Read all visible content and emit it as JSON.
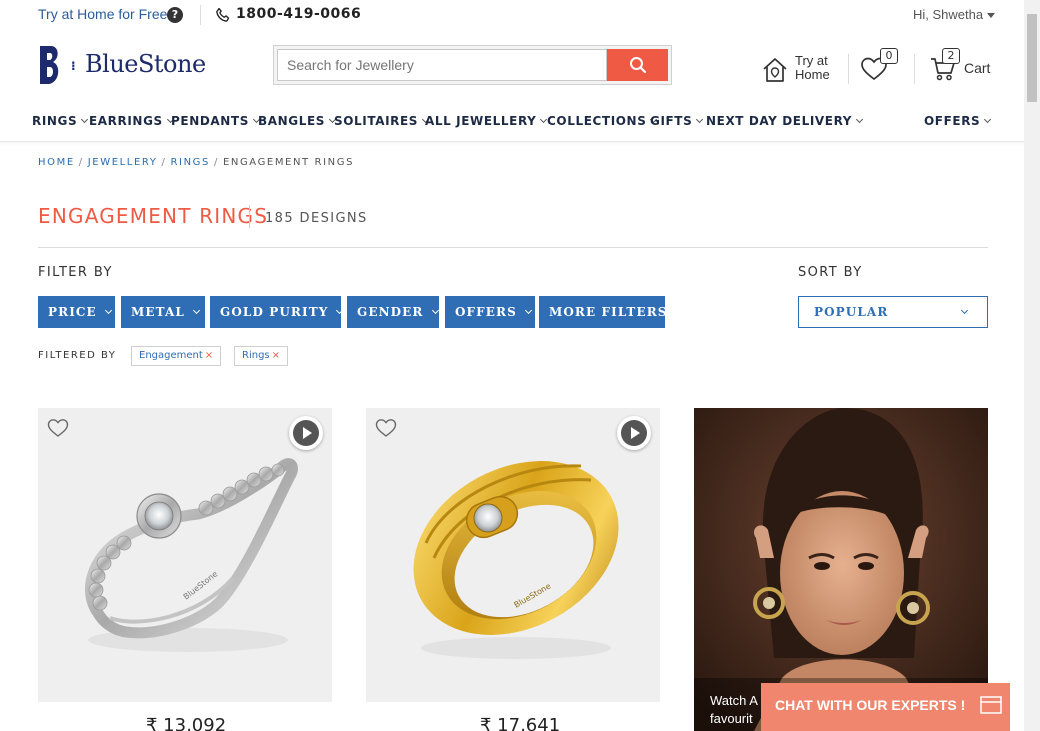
{
  "topbar": {
    "try_home": "Try at Home for Free",
    "help_glyph": "?",
    "phone": "1800-419-0066",
    "greeting": "Hi, Shwetha"
  },
  "header": {
    "logo_text": "BlueStone",
    "search": {
      "placeholder": "Search for Jewellery",
      "value": ""
    },
    "try_home_line1": "Try at",
    "try_home_line2": "Home",
    "wishlist_count": "0",
    "cart_count": "2",
    "cart_label": "Cart"
  },
  "nav": [
    {
      "label": "RINGS"
    },
    {
      "label": "EARRINGS"
    },
    {
      "label": "PENDANTS"
    },
    {
      "label": "BANGLES"
    },
    {
      "label": "SOLITAIRES"
    },
    {
      "label": "ALL JEWELLERY"
    },
    {
      "label": "COLLECTIONS"
    },
    {
      "label": "GIFTS"
    },
    {
      "label": "NEXT DAY DELIVERY"
    },
    {
      "label": "OFFERS"
    }
  ],
  "breadcrumb": {
    "items": [
      "HOME",
      "JEWELLERY",
      "RINGS"
    ],
    "separator": "/",
    "current": "ENGAGEMENT RINGS"
  },
  "page": {
    "title": "ENGAGEMENT RINGS",
    "count": "185 DESIGNS"
  },
  "filters": {
    "label": "FILTER BY",
    "buttons": [
      "PRICE",
      "METAL",
      "GOLD PURITY",
      "GENDER",
      "OFFERS",
      "MORE FILTERS"
    ],
    "applied_label": "FILTERED BY",
    "applied": [
      "Engagement",
      "Rings"
    ],
    "remove_glyph": "×"
  },
  "sort": {
    "label": "SORT BY",
    "selected": "POPULAR"
  },
  "products": [
    {
      "price": "₹ 13,092",
      "metal": "white gold"
    },
    {
      "price": "₹ 17,641",
      "metal": "yellow gold"
    }
  ],
  "ad": {
    "caption_line1": "Watch A",
    "caption_line2": "favourit"
  },
  "chat": {
    "label": "CHAT WITH OUR EXPERTS !"
  },
  "colors": {
    "brand_navy": "#1d2a6b",
    "accent_coral": "#ef5a45",
    "filter_blue": "#2f6db5",
    "link_blue": "#2b5c9c",
    "chat_bg": "#f1866e"
  }
}
